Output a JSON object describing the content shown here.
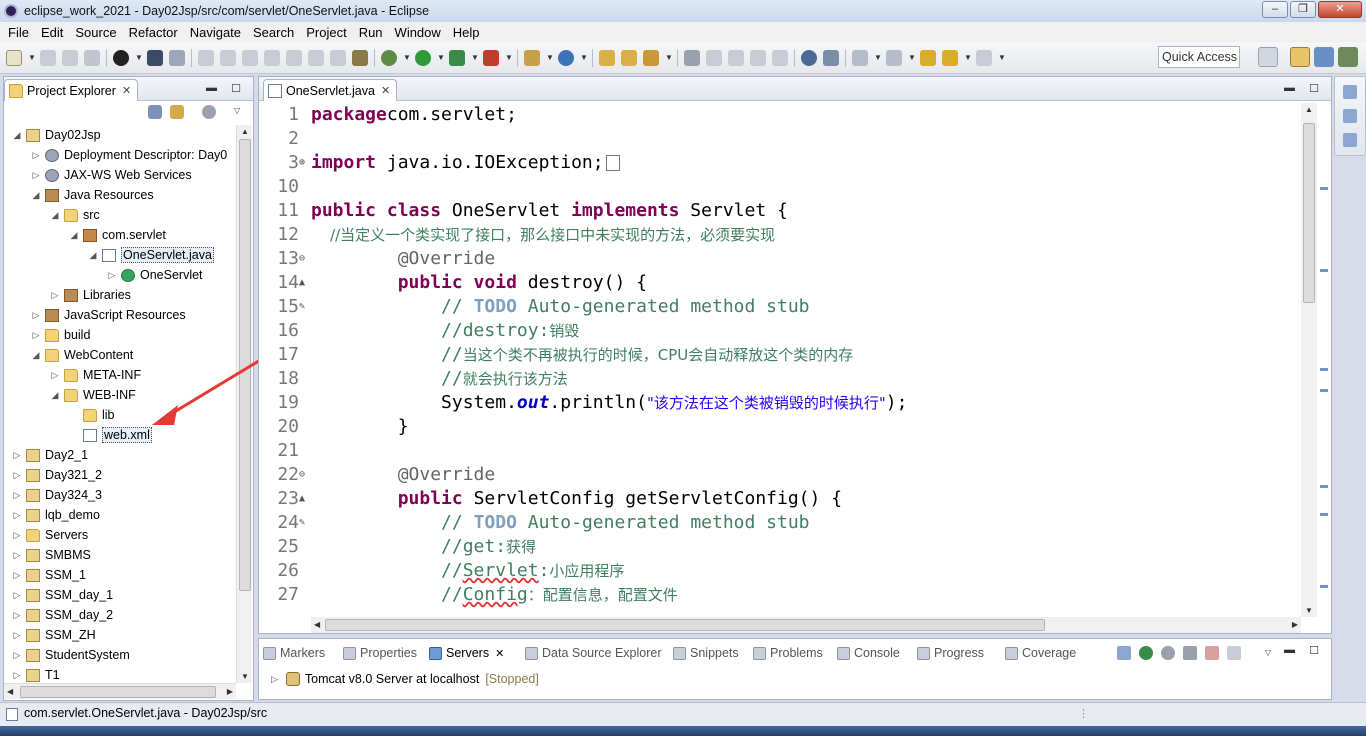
{
  "window": {
    "title": "eclipse_work_2021 - Day02Jsp/src/com/servlet/OneServlet.java - Eclipse",
    "controls": [
      "0",
      "1",
      "r"
    ]
  },
  "menu": [
    "File",
    "Edit",
    "Source",
    "Refactor",
    "Navigate",
    "Search",
    "Project",
    "Run",
    "Window",
    "Help"
  ],
  "toolbar": {
    "quick_access": "Quick Access"
  },
  "project_explorer": {
    "title": "Project Explorer",
    "tree": [
      {
        "label": "Day02Jsp",
        "depth": 0,
        "toggle": "◢",
        "icon": "project-icon"
      },
      {
        "label": "Deployment Descriptor: Day0",
        "depth": 1,
        "toggle": "▷",
        "icon": "deployment-descriptor-icon"
      },
      {
        "label": "JAX-WS Web Services",
        "depth": 1,
        "toggle": "▷",
        "icon": "web-services-icon"
      },
      {
        "label": "Java Resources",
        "depth": 1,
        "toggle": "◢",
        "icon": "java-resources-icon"
      },
      {
        "label": "src",
        "depth": 2,
        "toggle": "◢",
        "icon": "source-folder-icon"
      },
      {
        "label": "com.servlet",
        "depth": 3,
        "toggle": "◢",
        "icon": "package-icon"
      },
      {
        "label": "OneServlet.java",
        "depth": 4,
        "toggle": "◢",
        "icon": "java-file-icon",
        "selected": true
      },
      {
        "label": "OneServlet",
        "depth": 5,
        "toggle": "▷",
        "icon": "class-icon"
      },
      {
        "label": "Libraries",
        "depth": 2,
        "toggle": "▷",
        "icon": "libraries-icon"
      },
      {
        "label": "JavaScript Resources",
        "depth": 1,
        "toggle": "▷",
        "icon": "javascript-resources-icon"
      },
      {
        "label": "build",
        "depth": 1,
        "toggle": "▷",
        "icon": "folder-icon"
      },
      {
        "label": "WebContent",
        "depth": 1,
        "toggle": "◢",
        "icon": "folder-icon"
      },
      {
        "label": "META-INF",
        "depth": 2,
        "toggle": "▷",
        "icon": "folder-icon"
      },
      {
        "label": "WEB-INF",
        "depth": 2,
        "toggle": "◢",
        "icon": "folder-icon"
      },
      {
        "label": "lib",
        "depth": 3,
        "toggle": "",
        "icon": "folder-icon"
      },
      {
        "label": "web.xml",
        "depth": 3,
        "toggle": "",
        "icon": "xml-file-icon",
        "boxed": true
      },
      {
        "label": "Day2_1",
        "depth": 0,
        "toggle": "▷",
        "icon": "project-icon"
      },
      {
        "label": "Day321_2",
        "depth": 0,
        "toggle": "▷",
        "icon": "project-icon"
      },
      {
        "label": "Day324_3",
        "depth": 0,
        "toggle": "▷",
        "icon": "project-icon"
      },
      {
        "label": "lqb_demo",
        "depth": 0,
        "toggle": "▷",
        "icon": "project-icon"
      },
      {
        "label": "Servers",
        "depth": 0,
        "toggle": "▷",
        "icon": "folder-icon"
      },
      {
        "label": "SMBMS",
        "depth": 0,
        "toggle": "▷",
        "icon": "project-icon"
      },
      {
        "label": "SSM_1",
        "depth": 0,
        "toggle": "▷",
        "icon": "project-icon"
      },
      {
        "label": "SSM_day_1",
        "depth": 0,
        "toggle": "▷",
        "icon": "project-icon"
      },
      {
        "label": "SSM_day_2",
        "depth": 0,
        "toggle": "▷",
        "icon": "project-icon"
      },
      {
        "label": "SSM_ZH",
        "depth": 0,
        "toggle": "▷",
        "icon": "project-icon"
      },
      {
        "label": "StudentSystem",
        "depth": 0,
        "toggle": "▷",
        "icon": "project-icon"
      },
      {
        "label": "T1",
        "depth": 0,
        "toggle": "▷",
        "icon": "project-icon"
      }
    ]
  },
  "editor": {
    "tab": "OneServlet.java",
    "lines": [
      {
        "n": "1",
        "m": "",
        "parts": [
          [
            "kw",
            "package"
          ],
          [
            "",
            "com.servlet;"
          ]
        ]
      },
      {
        "n": "2",
        "m": "",
        "parts": []
      },
      {
        "n": "3",
        "m": "⊕",
        "parts": [
          [
            "kw",
            "import"
          ],
          [
            "",
            " java.io.IOException;"
          ],
          [
            "fold",
            ""
          ]
        ]
      },
      {
        "n": "10",
        "m": "",
        "parts": []
      },
      {
        "n": "11",
        "m": "",
        "parts": [
          [
            "kw",
            "public class"
          ],
          [
            "",
            " OneServlet "
          ],
          [
            "kw",
            "implements"
          ],
          [
            "",
            " Servlet {"
          ]
        ]
      },
      {
        "n": "12",
        "m": "",
        "parts": [
          [
            "cmz",
            "    //当定义一个类实现了接口，那么接口中未实现的方法，必须要实现"
          ]
        ]
      },
      {
        "n": "13",
        "m": "⊖",
        "parts": [
          [
            "ann",
            "        @Override"
          ]
        ]
      },
      {
        "n": "14",
        "m": "▲",
        "parts": [
          [
            "",
            "        "
          ],
          [
            "kw",
            "public void"
          ],
          [
            "",
            " destroy() {"
          ]
        ]
      },
      {
        "n": "15",
        "m": "✎",
        "parts": [
          [
            "cm",
            "            // "
          ],
          [
            "todo",
            "TODO"
          ],
          [
            "cm",
            " Auto-generated method stub"
          ]
        ]
      },
      {
        "n": "16",
        "m": "",
        "parts": [
          [
            "cm",
            "            //destroy:"
          ],
          [
            "cmz",
            "销毁"
          ]
        ]
      },
      {
        "n": "17",
        "m": "",
        "parts": [
          [
            "cm",
            "            //"
          ],
          [
            "cmz",
            "当这个类不再被执行的时候，CPU会自动释放这个类的内存"
          ]
        ]
      },
      {
        "n": "18",
        "m": "",
        "parts": [
          [
            "cm",
            "            //"
          ],
          [
            "cmz",
            "就会执行该方法"
          ]
        ]
      },
      {
        "n": "19",
        "m": "",
        "parts": [
          [
            "",
            "            System."
          ],
          [
            "fld",
            "out"
          ],
          [
            "",
            ".println("
          ],
          [
            "strz",
            "\"该方法在这个类被销毁的时候执行\""
          ],
          [
            "",
            ");"
          ]
        ]
      },
      {
        "n": "20",
        "m": "",
        "parts": [
          [
            "",
            "        }"
          ]
        ]
      },
      {
        "n": "21",
        "m": "",
        "parts": []
      },
      {
        "n": "22",
        "m": "⊖",
        "parts": [
          [
            "ann",
            "        @Override"
          ]
        ]
      },
      {
        "n": "23",
        "m": "▲",
        "parts": [
          [
            "",
            "        "
          ],
          [
            "kw",
            "public"
          ],
          [
            "",
            " ServletConfig getServletConfig() {"
          ]
        ]
      },
      {
        "n": "24",
        "m": "✎",
        "parts": [
          [
            "cm",
            "            // "
          ],
          [
            "todo",
            "TODO"
          ],
          [
            "cm",
            " Auto-generated method stub"
          ]
        ]
      },
      {
        "n": "25",
        "m": "",
        "parts": [
          [
            "cm",
            "            //get:"
          ],
          [
            "cmz",
            "获得"
          ]
        ]
      },
      {
        "n": "26",
        "m": "",
        "parts": [
          [
            "cm",
            "            //"
          ],
          [
            "cm squig",
            "Servlet"
          ],
          [
            "cm",
            ":"
          ],
          [
            "cmz",
            "小应用程序"
          ]
        ]
      },
      {
        "n": "27",
        "m": "",
        "parts": [
          [
            "cm",
            "            //"
          ],
          [
            "cm squig",
            "Config"
          ],
          [
            "cmz",
            "：配置信息，配置文件"
          ]
        ]
      }
    ]
  },
  "bottom_panel": {
    "tabs": [
      {
        "label": "Markers",
        "active": false
      },
      {
        "label": "Properties",
        "active": false
      },
      {
        "label": "Servers",
        "active": true
      },
      {
        "label": "Data Source Explorer",
        "active": false
      },
      {
        "label": "Snippets",
        "active": false
      },
      {
        "label": "Problems",
        "active": false
      },
      {
        "label": "Console",
        "active": false
      },
      {
        "label": "Progress",
        "active": false
      },
      {
        "label": "Coverage",
        "active": false
      }
    ],
    "server": {
      "name": "Tomcat v8.0 Server at localhost",
      "status": "[Stopped]"
    }
  },
  "status_bar": {
    "text": "com.servlet.OneServlet.java - Day02Jsp/src"
  },
  "colors": {
    "keyword": "#7f0055",
    "comment": "#3f7f5f",
    "string": "#2a00ff",
    "annotation": "#646464",
    "arrow": "#e53935"
  }
}
